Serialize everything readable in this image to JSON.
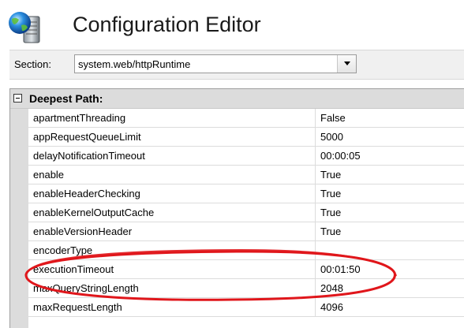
{
  "window": {
    "title": "Configuration Editor",
    "icon": "server-config-icon"
  },
  "section": {
    "label": "Section:",
    "value": "system.web/httpRuntime"
  },
  "grid": {
    "group_title": "Deepest Path:",
    "rows": [
      {
        "name": "apartmentThreading",
        "value": "False"
      },
      {
        "name": "appRequestQueueLimit",
        "value": "5000"
      },
      {
        "name": "delayNotificationTimeout",
        "value": "00:00:05"
      },
      {
        "name": "enable",
        "value": "True"
      },
      {
        "name": "enableHeaderChecking",
        "value": "True"
      },
      {
        "name": "enableKernelOutputCache",
        "value": "True"
      },
      {
        "name": "enableVersionHeader",
        "value": "True"
      },
      {
        "name": "encoderType",
        "value": ""
      },
      {
        "name": "executionTimeout",
        "value": "00:01:50"
      },
      {
        "name": "maxQueryStringLength",
        "value": "2048"
      },
      {
        "name": "maxRequestLength",
        "value": "4096"
      }
    ]
  },
  "colors": {
    "annotation": "#e0161b",
    "gutter": "#dcdcdc"
  }
}
